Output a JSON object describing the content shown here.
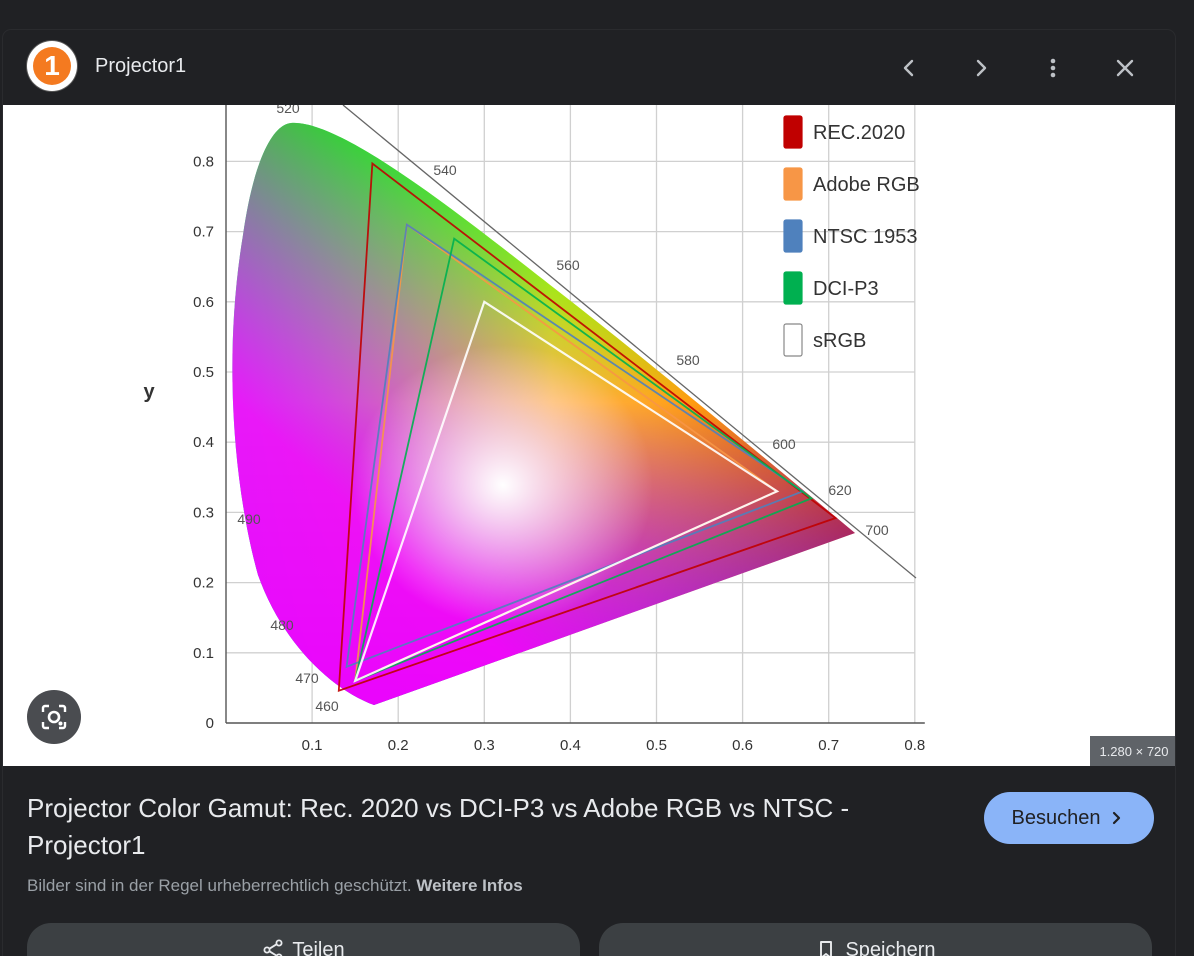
{
  "header": {
    "site_name": "Projector1",
    "logo_text": "1",
    "prev_icon": "chevron-left-icon",
    "next_icon": "chevron-right-icon",
    "more_icon": "more-vert-icon",
    "close_icon": "close-icon"
  },
  "image": {
    "dimensions": "1.280 × 720",
    "lens_icon": "lens-search-icon"
  },
  "chart_data": {
    "type": "scatter",
    "ylabel": "y",
    "xlabel": "",
    "xlim": [
      0,
      0.8
    ],
    "ylim": [
      0,
      0.85
    ],
    "x_ticks": [
      "0.1",
      "0.2",
      "0.3",
      "0.4",
      "0.5",
      "0.6",
      "0.7",
      "0.8"
    ],
    "y_ticks": [
      "0",
      "0.1",
      "0.2",
      "0.3",
      "0.4",
      "0.5",
      "0.6",
      "0.7",
      "0.8"
    ],
    "wavelength_labels": [
      "460",
      "470",
      "480",
      "490",
      "520",
      "540",
      "560",
      "580",
      "600",
      "620",
      "700"
    ],
    "legend": [
      "REC.2020",
      "Adobe RGB",
      "NTSC 1953",
      "DCI-P3",
      "sRGB"
    ],
    "series": [
      {
        "name": "REC.2020",
        "color": "#c00000",
        "points": [
          [
            0.708,
            0.292
          ],
          [
            0.17,
            0.797
          ],
          [
            0.131,
            0.046
          ]
        ]
      },
      {
        "name": "Adobe RGB",
        "color": "#f79646",
        "points": [
          [
            0.64,
            0.33
          ],
          [
            0.21,
            0.71
          ],
          [
            0.15,
            0.06
          ]
        ]
      },
      {
        "name": "NTSC 1953",
        "color": "#4f81bd",
        "points": [
          [
            0.67,
            0.33
          ],
          [
            0.21,
            0.71
          ],
          [
            0.14,
            0.08
          ]
        ]
      },
      {
        "name": "DCI-P3",
        "color": "#00b050",
        "points": [
          [
            0.68,
            0.32
          ],
          [
            0.265,
            0.69
          ],
          [
            0.15,
            0.06
          ]
        ]
      },
      {
        "name": "sRGB",
        "color": "#ffffff",
        "points": [
          [
            0.64,
            0.33
          ],
          [
            0.3,
            0.6
          ],
          [
            0.15,
            0.06
          ]
        ]
      }
    ]
  },
  "main": {
    "title": "Projector Color Gamut: Rec. 2020 vs DCI-P3 vs Adobe RGB vs NTSC - Projector1",
    "visit_label": "Besuchen",
    "copyright_text": "Bilder sind in der Regel urheberrechtlich geschützt.",
    "more_info_label": "Weitere Infos",
    "share_label": "Teilen",
    "save_label": "Speichern"
  }
}
